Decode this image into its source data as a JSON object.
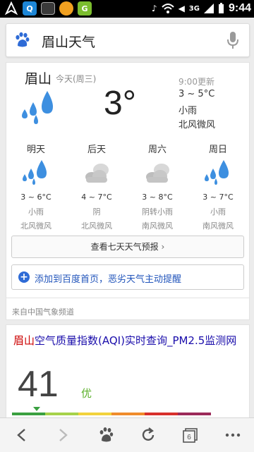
{
  "statusbar": {
    "time": "9:44",
    "network": "3G",
    "ic_qq": "Q",
    "ic_box": "G"
  },
  "search": {
    "query": "眉山天气"
  },
  "weather": {
    "city": "眉山",
    "today_label": "今天(周三)",
    "current_temp": "3°",
    "update_time": "9:00更新",
    "today_range": "3 ~ 5°C",
    "today_condition": "小雨",
    "today_wind": "北风微风",
    "forecast": [
      {
        "day": "明天",
        "icon": "rain-icon",
        "range": "3 ~ 6°C",
        "condition": "小雨",
        "wind": "北风微风"
      },
      {
        "day": "后天",
        "icon": "cloudy-icon",
        "range": "4 ~ 7°C",
        "condition": "阴",
        "wind": "北风微风"
      },
      {
        "day": "周六",
        "icon": "cloudy-icon",
        "range": "3 ~ 8°C",
        "condition": "阴转小雨",
        "wind": "南风微风"
      },
      {
        "day": "周日",
        "icon": "rain-icon",
        "range": "3 ~ 7°C",
        "condition": "小雨",
        "wind": "南风微风"
      }
    ],
    "seven_day_button": "查看七天天气预报",
    "add_button": "添加到百度首页，恶劣天气主动提醒",
    "source": "来自中国气象频道"
  },
  "aqi": {
    "title_highlight": "眉山",
    "title_rest": "空气质量指数(AQI)实时查询_PM2.5监测网",
    "value": "41",
    "level": "优",
    "scale_colors": [
      "#3aa040",
      "#a6d24a",
      "#f2d23c",
      "#f08c2c",
      "#d8302c",
      "#9c2a5a"
    ]
  },
  "colors": {
    "accent": "#2e6bd6",
    "rain_blue": "#3d8fe0",
    "good": "#5bb02a"
  }
}
